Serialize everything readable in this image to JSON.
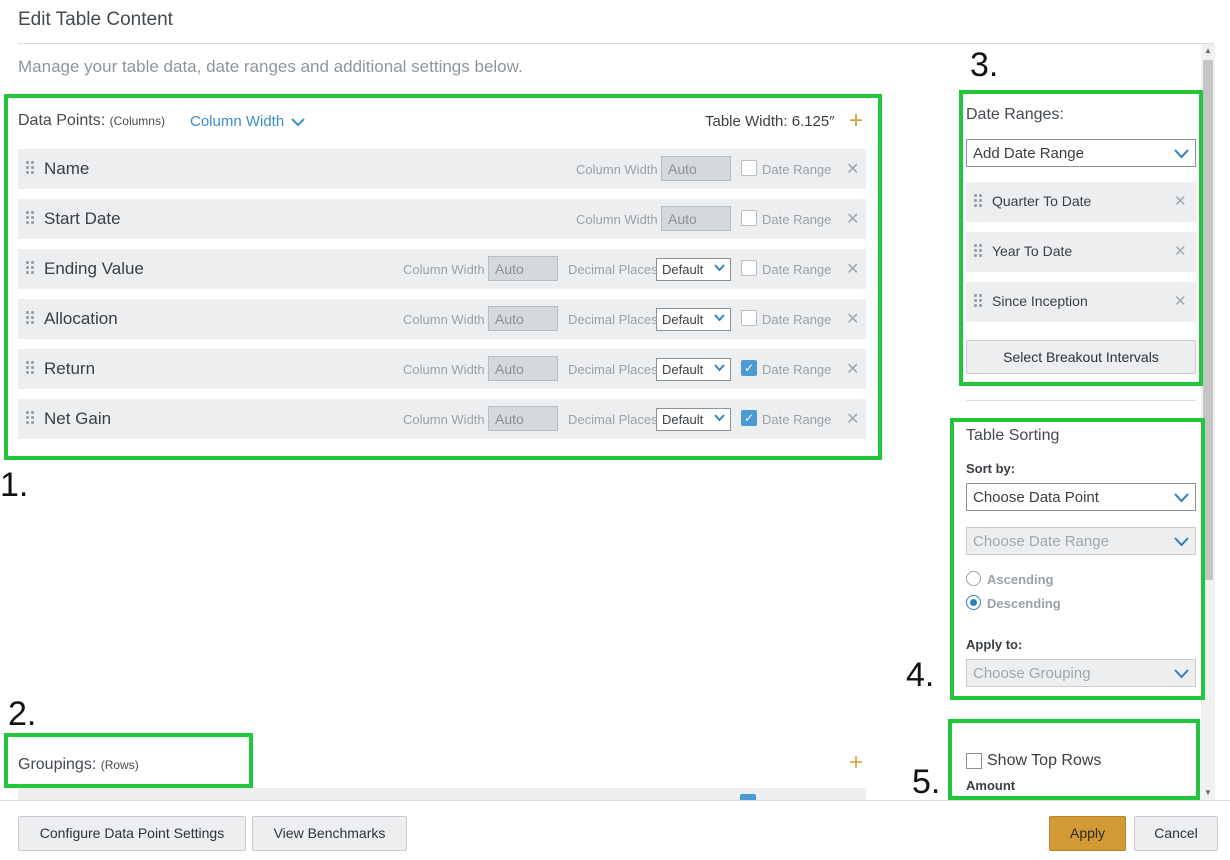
{
  "dialog": {
    "title": "Edit Table Content",
    "subtitle": "Manage your table data, date ranges and additional settings below."
  },
  "annotations": [
    "1.",
    "2.",
    "3.",
    "4.",
    "5."
  ],
  "data_points": {
    "label": "Data Points:",
    "label_sub": "(Columns)",
    "column_width_link": "Column Width",
    "table_width": "Table Width: 6.125″",
    "col_width_label": "Column Width",
    "decimal_label": "Decimal Places",
    "date_range_label": "Date Range",
    "rows": [
      {
        "name": "Name",
        "width": "Auto",
        "decimals": null,
        "date_range": false
      },
      {
        "name": "Start Date",
        "width": "Auto",
        "decimals": null,
        "date_range": false
      },
      {
        "name": "Ending Value",
        "width": "Auto",
        "decimals": "Default",
        "date_range": false
      },
      {
        "name": "Allocation",
        "width": "Auto",
        "decimals": "Default",
        "date_range": false
      },
      {
        "name": "Return",
        "width": "Auto",
        "decimals": "Default",
        "date_range": true
      },
      {
        "name": "Net Gain",
        "width": "Auto",
        "decimals": "Default",
        "date_range": true
      }
    ]
  },
  "date_ranges": {
    "label": "Date Ranges:",
    "add_select": "Add Date Range",
    "items": [
      "Quarter To Date",
      "Year To Date",
      "Since Inception"
    ],
    "breakout_button": "Select Breakout Intervals"
  },
  "sorting": {
    "label": "Table Sorting",
    "sort_by_label": "Sort by:",
    "data_point_select": "Choose Data Point",
    "date_range_select": "Choose Date Range",
    "ascending": "Ascending",
    "descending": "Descending",
    "selected_order": "descending",
    "apply_to_label": "Apply to:",
    "grouping_select": "Choose Grouping"
  },
  "top_rows": {
    "checkbox_label": "Show Top Rows",
    "amount_label": "Amount",
    "checked": false
  },
  "groupings": {
    "label": "Groupings:",
    "label_sub": "(Rows)"
  },
  "footer": {
    "configure_button": "Configure Data Point Settings",
    "benchmarks_button": "View Benchmarks",
    "apply_button": "Apply",
    "cancel_button": "Cancel"
  },
  "colors": {
    "highlight": "#22c63b",
    "link": "#3a8fc9",
    "accent": "#d6a53a",
    "apply_bg": "#d29a35",
    "checkbox_on": "#4a9ad4"
  }
}
